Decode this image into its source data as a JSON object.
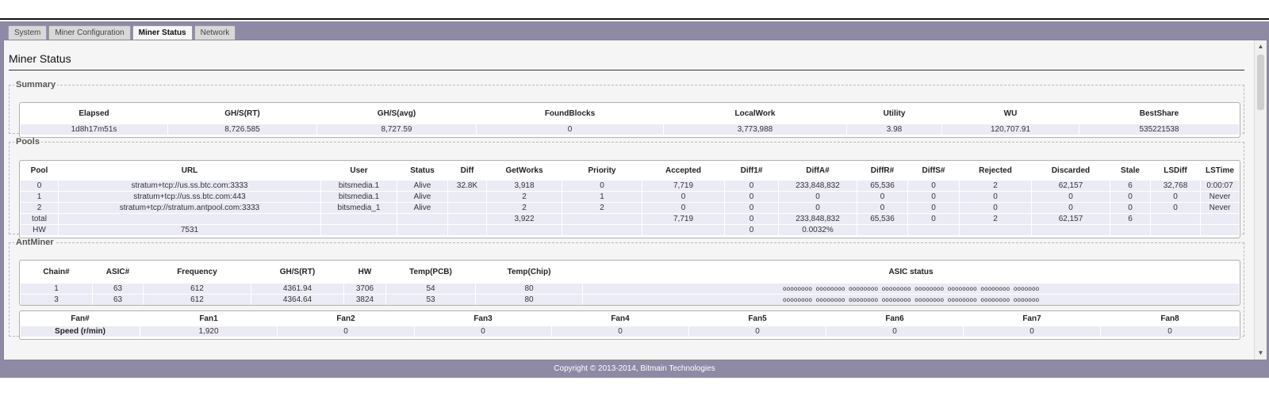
{
  "tabs": [
    "System",
    "Miner Configuration",
    "Miner Status",
    "Network"
  ],
  "page_title": "Miner Status",
  "summary": {
    "legend": "Summary",
    "headers": [
      "Elapsed",
      "GH/S(RT)",
      "GH/S(avg)",
      "FoundBlocks",
      "LocalWork",
      "Utility",
      "WU",
      "BestShare"
    ],
    "row": [
      "1d8h17m51s",
      "8,726.585",
      "8,727.59",
      "0",
      "3,773,988",
      "3.98",
      "120,707.91",
      "535221538"
    ]
  },
  "pools": {
    "legend": "Pools",
    "headers": [
      "Pool",
      "URL",
      "User",
      "Status",
      "Diff",
      "GetWorks",
      "Priority",
      "Accepted",
      "Diff1#",
      "DiffA#",
      "DiffR#",
      "DiffS#",
      "Rejected",
      "Discarded",
      "Stale",
      "LSDiff",
      "LSTime"
    ],
    "rows": [
      [
        "0",
        "stratum+tcp://us.ss.btc.com:3333",
        "bitsmedia.1",
        "Alive",
        "32.8K",
        "3,918",
        "0",
        "7,719",
        "0",
        "233,848,832",
        "65,536",
        "0",
        "2",
        "62,157",
        "6",
        "32,768",
        "0:00:07"
      ],
      [
        "1",
        "stratum+tcp://us.ss.btc.com:443",
        "bitsmedia.1",
        "Alive",
        "",
        "2",
        "1",
        "0",
        "0",
        "0",
        "0",
        "0",
        "0",
        "0",
        "0",
        "0",
        "Never"
      ],
      [
        "2",
        "stratum+tcp://stratum.antpool.com:3333",
        "bitsmedia_1",
        "Alive",
        "",
        "2",
        "2",
        "0",
        "0",
        "0",
        "0",
        "0",
        "0",
        "0",
        "0",
        "0",
        "Never"
      ],
      [
        "total",
        "",
        "",
        "",
        "",
        "3,922",
        "",
        "7,719",
        "0",
        "233,848,832",
        "65,536",
        "0",
        "2",
        "62,157",
        "6",
        "",
        ""
      ],
      [
        "HW",
        "7531",
        "",
        "",
        "",
        "",
        "",
        "",
        "0",
        "0.0032%",
        "",
        "",
        "",
        "",
        "",
        "",
        ""
      ]
    ]
  },
  "antminer": {
    "legend": "AntMiner",
    "headers": [
      "Chain#",
      "ASIC#",
      "Frequency",
      "GH/S(RT)",
      "HW",
      "Temp(PCB)",
      "Temp(Chip)",
      "ASIC status"
    ],
    "rows": [
      [
        "1",
        "63",
        "612",
        "4361.94",
        "3706",
        "54",
        "80",
        "oooooooo oooooooo oooooooo oooooooo oooooooo oooooooo oooooooo ooooooo"
      ],
      [
        "3",
        "63",
        "612",
        "4364.64",
        "3824",
        "53",
        "80",
        "oooooooo oooooooo oooooooo oooooooo oooooooo oooooooo oooooooo ooooooo"
      ]
    ],
    "fans": {
      "headers": [
        "Fan#",
        "Fan1",
        "Fan2",
        "Fan3",
        "Fan4",
        "Fan5",
        "Fan6",
        "Fan7",
        "Fan8"
      ],
      "row": [
        "Speed (r/min)",
        "1,920",
        "0",
        "0",
        "0",
        "0",
        "0",
        "0",
        "0"
      ]
    }
  },
  "footer": "Copyright © 2013-2014, Bitmain Technologies",
  "colors": {
    "band": "#8e8aa6",
    "cell": "#ebebf5",
    "panel": "#f5f5f5"
  },
  "icons": {
    "scroll_up": "up-arrow-icon",
    "scroll_down": "down-arrow-icon"
  }
}
